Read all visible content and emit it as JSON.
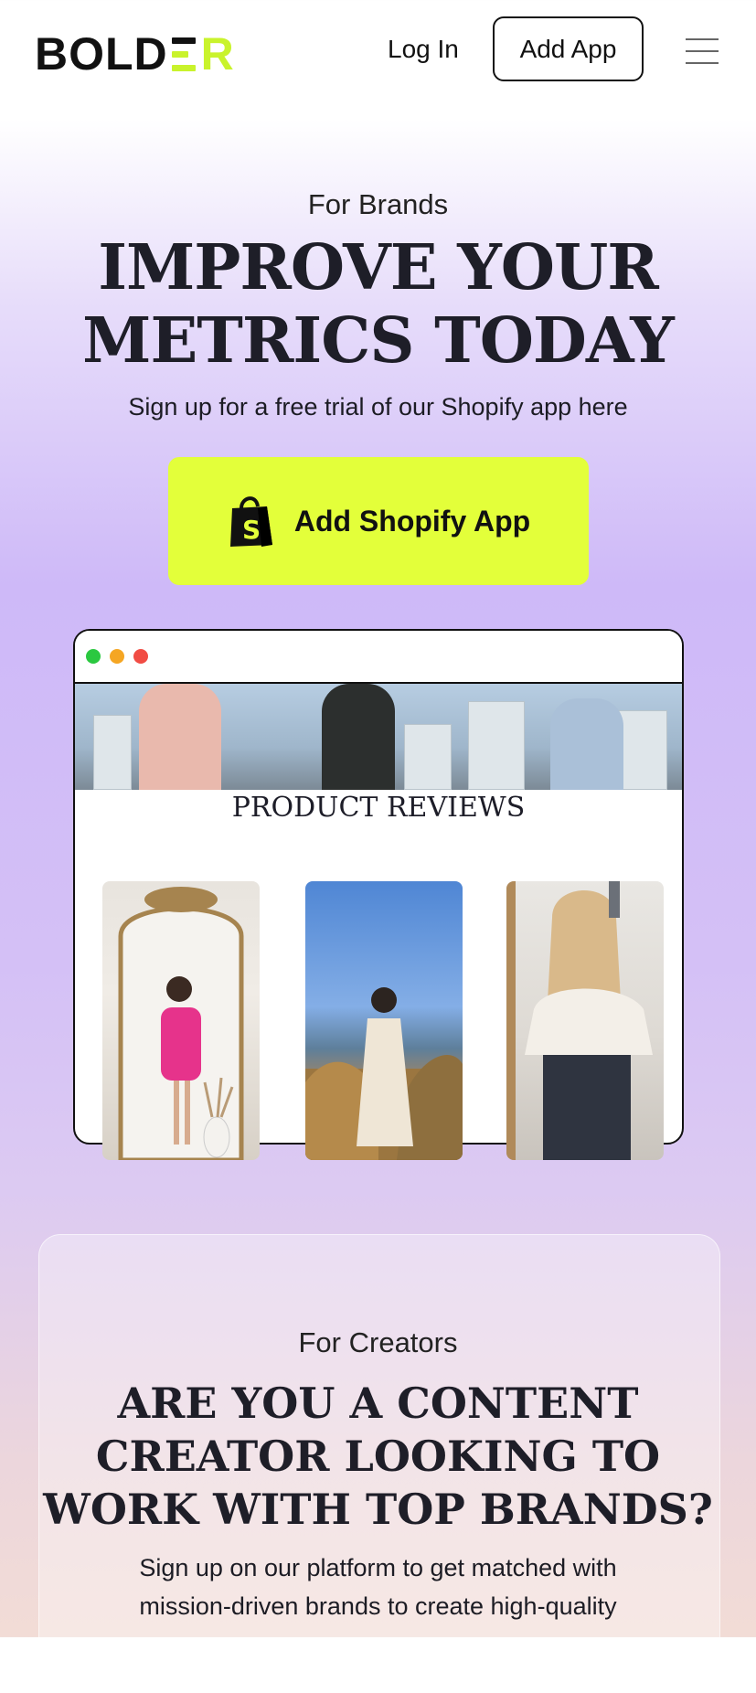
{
  "header": {
    "logo_text_left": "BOLD",
    "logo_text_right": "R",
    "login_label": "Log In",
    "add_app_label": "Add App"
  },
  "hero": {
    "eyebrow": "For Brands",
    "title_line1": "IMPROVE YOUR",
    "title_line2": "METRICS TODAY",
    "subtitle": "Sign up for a free trial of our Shopify app here",
    "cta_label": "Add Shopify App",
    "cta_color": "#e3ff3a"
  },
  "preview": {
    "section_title": "PRODUCT REVIEWS",
    "window_dots": [
      "#2bc840",
      "#f5a623",
      "#f14c44"
    ]
  },
  "creators": {
    "eyebrow": "For Creators",
    "title_line1": "ARE YOU A CONTENT",
    "title_line2": "CREATOR LOOKING TO",
    "title_line3": "WORK WITH TOP BRANDS?",
    "subtitle_line1": "Sign up on our platform to get matched with",
    "subtitle_line2": "mission-driven brands to create high-quality"
  }
}
